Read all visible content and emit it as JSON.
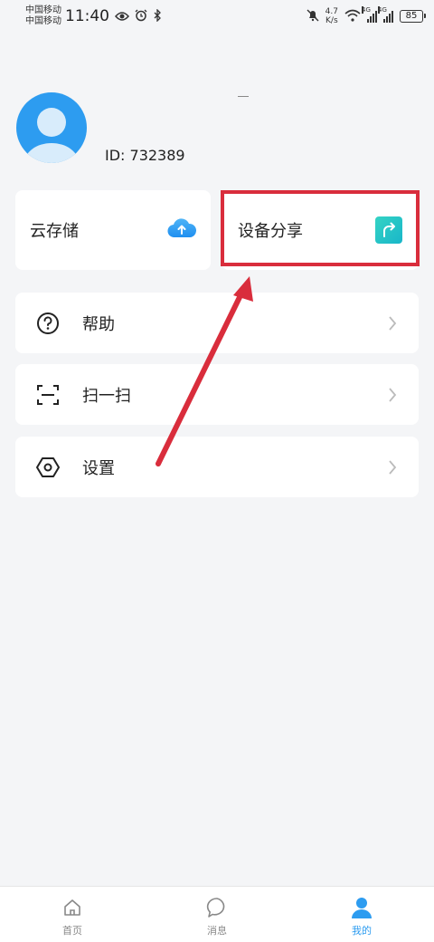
{
  "status_bar": {
    "carrier_1": "中国移动",
    "carrier_2": "中国移动",
    "time": "11:40",
    "speed_value": "4.7",
    "speed_unit": "K/s",
    "network_1": "4G",
    "network_2": "4G",
    "battery": "85"
  },
  "profile": {
    "user_id": "ID: 732389"
  },
  "cards": {
    "cloud_label": "云存储",
    "share_label": "设备分享"
  },
  "menu": [
    {
      "label": "帮助",
      "icon": "help-circle-icon"
    },
    {
      "label": "扫一扫",
      "icon": "scan-icon"
    },
    {
      "label": "设置",
      "icon": "settings-hexagon-icon"
    }
  ],
  "bottom_nav": [
    {
      "label": "首页",
      "icon": "home-icon",
      "active": false
    },
    {
      "label": "消息",
      "icon": "message-icon",
      "active": false
    },
    {
      "label": "我的",
      "icon": "profile-icon",
      "active": true
    }
  ],
  "colors": {
    "accent": "#2d9cf0",
    "highlight": "#d92d3c",
    "share_icon": "#22c3c8",
    "background": "#f4f5f7"
  }
}
